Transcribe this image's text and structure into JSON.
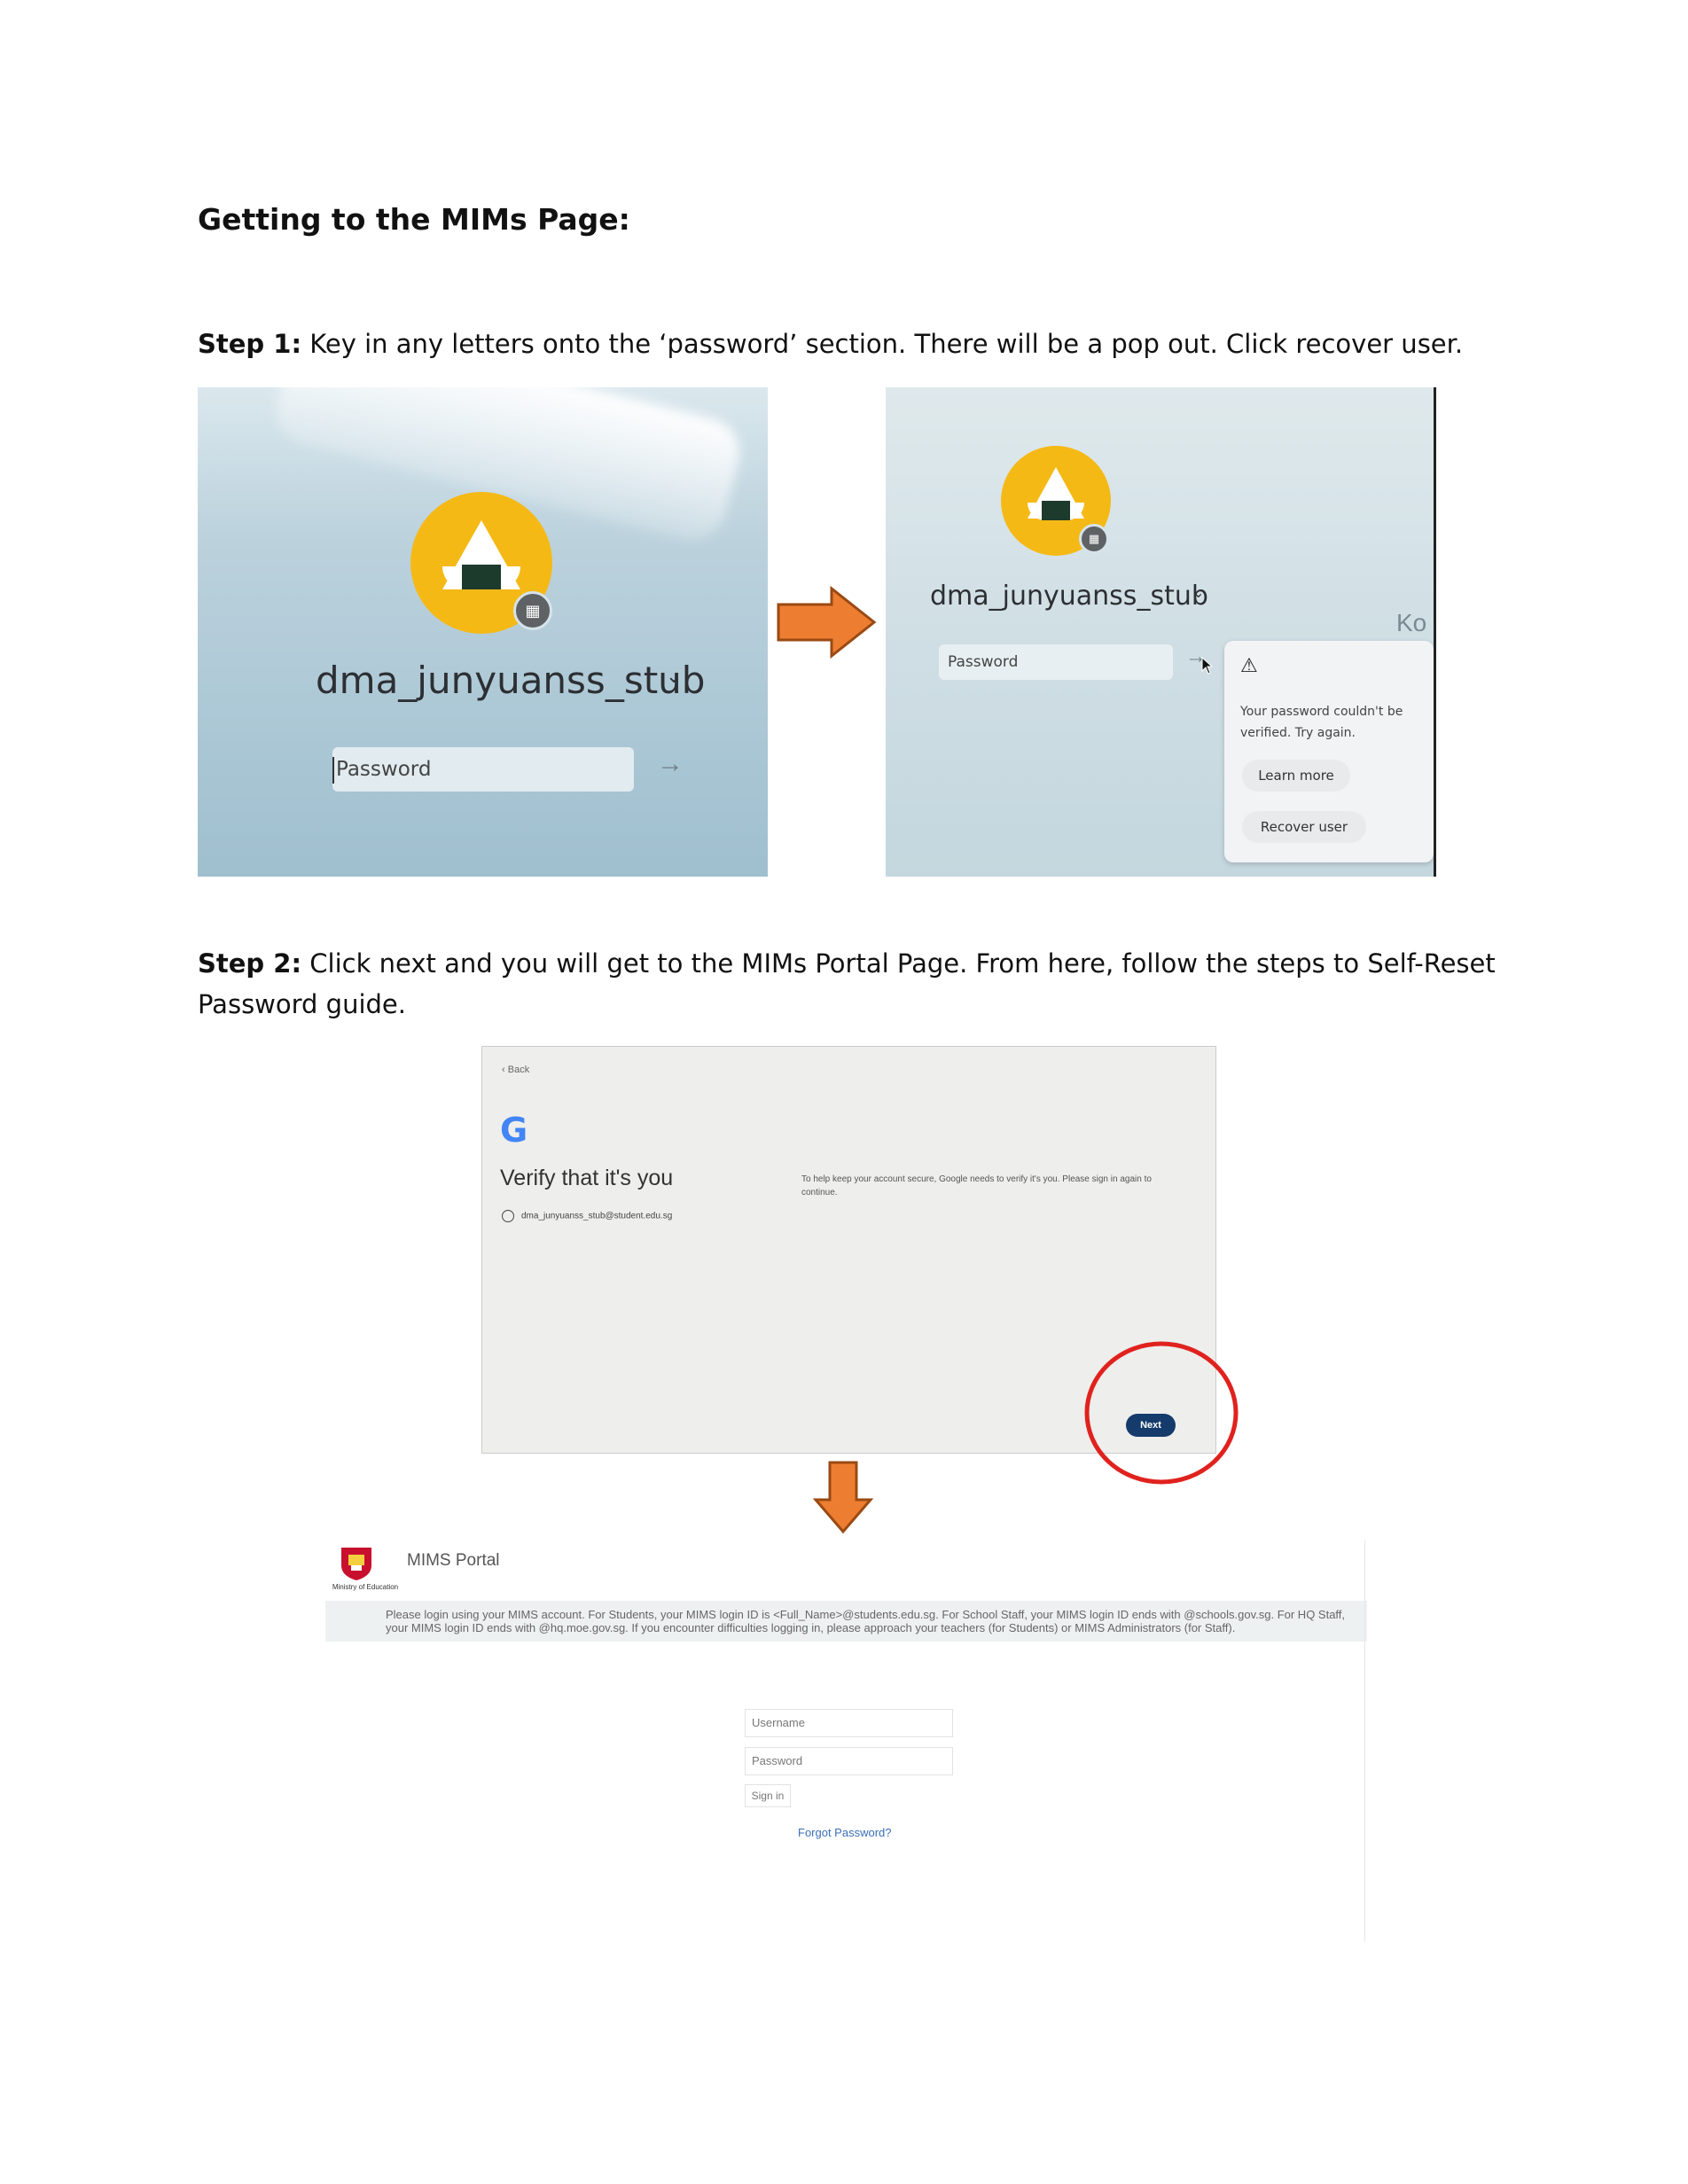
{
  "doc": {
    "heading": "Getting to the MIMs Page:",
    "step1_label": "Step 1:",
    "step1_text": " Key in any letters onto the ‘password’ section. There will be a pop out. Click recover user.",
    "step2_label": "Step 2:",
    "step2_line1": " Click next and you will get to the MIMs Portal Page. From here, follow the steps to Self-Reset",
    "step2_line2": "Password guide."
  },
  "photo1": {
    "username": "dma_junyuanss_stub",
    "password_placeholder": "Password"
  },
  "photo2": {
    "username": "dma_junyuanss_stub",
    "password_placeholder": "Password",
    "corner_text": "Ko",
    "popup_message": "Your password couldn't be verified. Try again.",
    "learn_more": "Learn more",
    "recover_user": "Recover user"
  },
  "photo3": {
    "back": "Back",
    "title": "Verify that it's you",
    "email": "dma_junyuanss_stub@student.edu.sg",
    "info": "To help keep your account secure, Google needs to verify it's you. Please sign in again to continue.",
    "next": "Next"
  },
  "mims": {
    "title": "MIMS Portal",
    "logo_caption": "Ministry of Education",
    "notice": "Please login using your MIMS account. For Students, your MIMS login ID is <Full_Name>@students.edu.sg. For School Staff, your MIMS login ID ends with @schools.gov.sg. For HQ Staff, your MIMS login ID ends with @hq.moe.gov.sg. If you encounter difficulties logging in, please approach your teachers (for Students) or MIMS Administrators (for Staff).",
    "username_placeholder": "Username",
    "password_placeholder": "Password",
    "signin": "Sign in",
    "forgot": "Forgot Password?"
  },
  "colors": {
    "arrow_orange": "#ED7D31",
    "highlight_red": "#E0221E",
    "google_blue": "#4285F4",
    "mims_link": "#3b6fb6"
  }
}
